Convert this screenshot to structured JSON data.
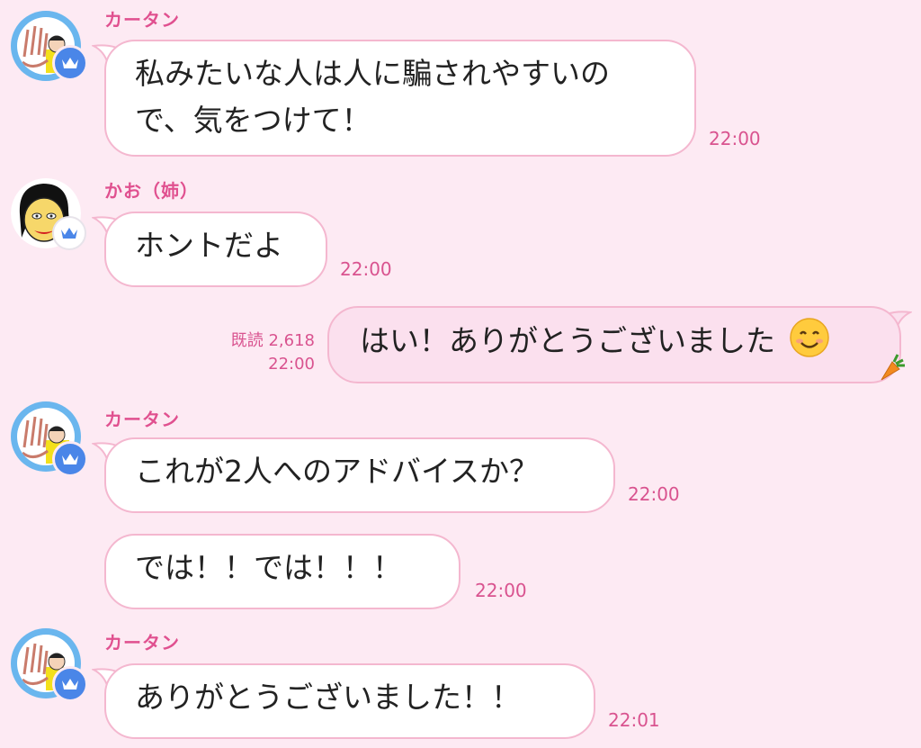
{
  "messages": [
    {
      "sender": "カータン",
      "lines": [
        "私みたいな人は人に騙されやすいの",
        "で、気をつけて！"
      ],
      "time": "22:00"
    },
    {
      "sender": "かお（姉）",
      "text": "ホントだよ",
      "time": "22:00"
    },
    {
      "text": "はい！ありがとうございました",
      "read": "既読 2,618",
      "time": "22:00",
      "emoji": "smiling-face"
    },
    {
      "sender": "カータン",
      "text": "これが2人へのアドバイスか？",
      "time": "22:00"
    },
    {
      "text": "では！！では！！！",
      "time": "22:00"
    },
    {
      "sender": "カータン",
      "text": "ありがとうございました！！",
      "time": "22:01"
    }
  ],
  "icons": {
    "badge": "crown-icon",
    "sticker": "carrot-icon"
  },
  "colors": {
    "background": "#fdeaf3",
    "name": "#e0508f",
    "bubble_border": "#f4b7cf",
    "my_bubble": "#fbe0ee",
    "badge": "#4a86e8"
  }
}
